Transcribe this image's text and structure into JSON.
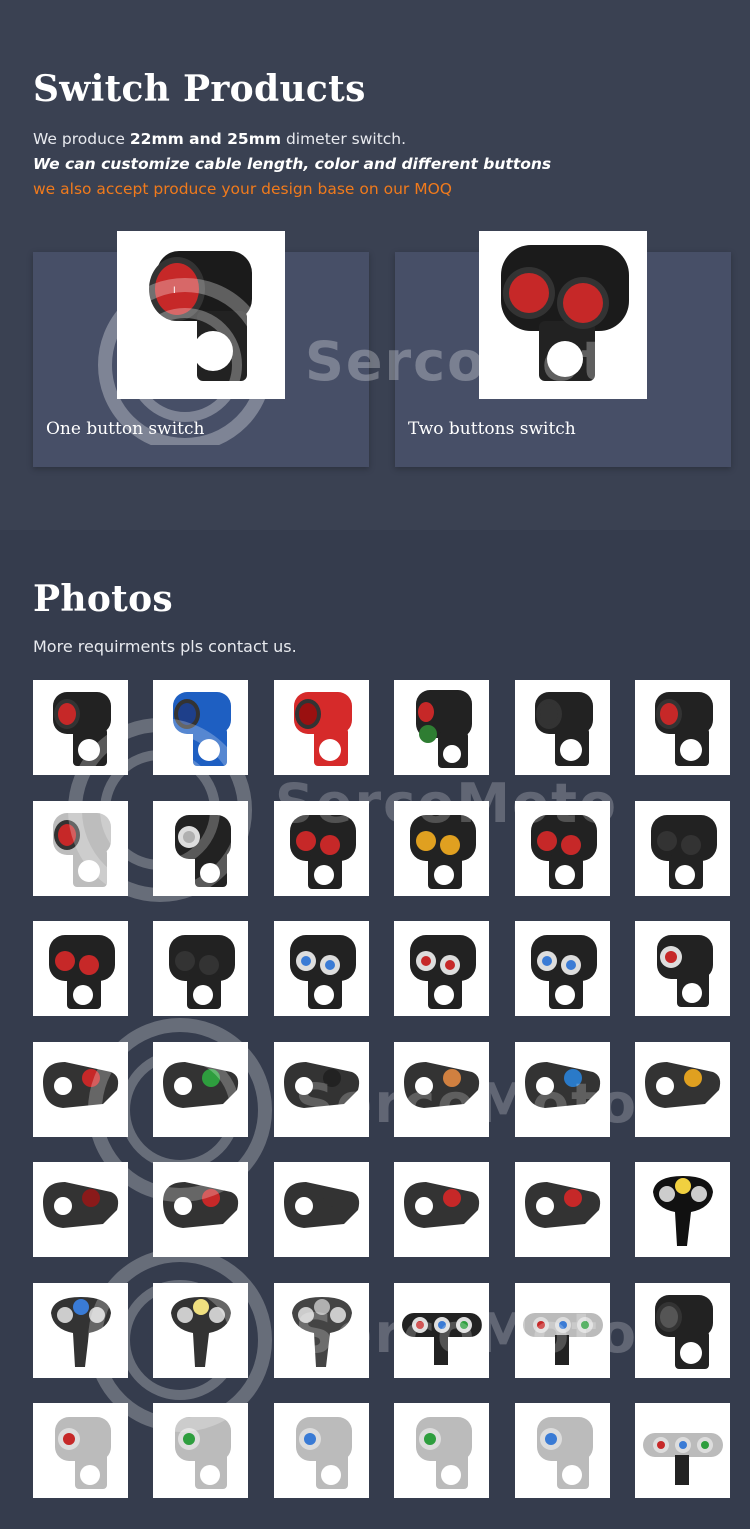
{
  "products": {
    "title": "Switch Products",
    "intro_prefix": "We produce ",
    "intro_bold": "22mm and 25mm",
    "intro_suffix": " dimeter switch.",
    "custom_line": "We can customize cable length, color and different buttons",
    "moq_line": "we also accept produce your design base on our MOQ",
    "accent_color": "#f07a1c",
    "cards": [
      {
        "caption": "One button switch"
      },
      {
        "caption": "Two buttons switch"
      }
    ]
  },
  "photos": {
    "title": "Photos",
    "subtitle": "More requirments pls contact us.",
    "tiles": [
      {
        "body": "#222",
        "btn": "#c62828",
        "kind": "single"
      },
      {
        "body": "#1e5fc2",
        "btn": "#1e3f8a",
        "kind": "single"
      },
      {
        "body": "#d62a2a",
        "btn": "#9a1010",
        "kind": "single"
      },
      {
        "body": "#222",
        "btn": "#c62828",
        "kind": "compass"
      },
      {
        "body": "#222",
        "btn": "#333",
        "kind": "single"
      },
      {
        "body": "#222",
        "btn": "#c62828",
        "kind": "single"
      },
      {
        "body": "#bdbdbd",
        "btn": "#c62828",
        "kind": "single"
      },
      {
        "body": "#222",
        "btn": "#b0b0b0",
        "kind": "ring"
      },
      {
        "body": "#222",
        "btn": "#c62828",
        "kind": "double"
      },
      {
        "body": "#222",
        "btn": "#e0a020",
        "kind": "double"
      },
      {
        "body": "#222",
        "btn": "#c62828",
        "kind": "double"
      },
      {
        "body": "#222",
        "btn": "#333",
        "kind": "double"
      },
      {
        "body": "#222",
        "btn": "#c62828",
        "kind": "double"
      },
      {
        "body": "#222",
        "btn": "#333",
        "kind": "double"
      },
      {
        "body": "#222",
        "btn": "#3a7bd5",
        "kind": "ringdouble"
      },
      {
        "body": "#222",
        "btn": "#c62828",
        "kind": "ringdouble"
      },
      {
        "body": "#222",
        "btn": "#3a7bd5",
        "kind": "ringdouble"
      },
      {
        "body": "#222",
        "btn": "#c62828",
        "kind": "ring"
      },
      {
        "body": "#333",
        "btn": "#c62828",
        "kind": "lever"
      },
      {
        "body": "#333",
        "btn": "#2e9e3e",
        "kind": "lever"
      },
      {
        "body": "#333",
        "btn": "#222",
        "kind": "lever"
      },
      {
        "body": "#333",
        "btn": "#d08040",
        "kind": "lever"
      },
      {
        "body": "#333",
        "btn": "#2a7ac8",
        "kind": "lever"
      },
      {
        "body": "#333",
        "btn": "#e0a020",
        "kind": "lever"
      },
      {
        "body": "#333",
        "btn": "#8a1a1a",
        "kind": "lever"
      },
      {
        "body": "#333",
        "btn": "#c62828",
        "kind": "lever"
      },
      {
        "body": "#333",
        "btn": "#333",
        "kind": "lever"
      },
      {
        "body": "#333",
        "btn": "#c62828",
        "kind": "lever"
      },
      {
        "body": "#333",
        "btn": "#c62828",
        "kind": "lever"
      },
      {
        "body": "#111",
        "btn": "#f0d040",
        "kind": "triple"
      },
      {
        "body": "#333",
        "btn": "#3a7bd5",
        "kind": "triple"
      },
      {
        "body": "#333",
        "btn": "#f0e080",
        "kind": "triple"
      },
      {
        "body": "#444",
        "btn": "#b0b0b0",
        "kind": "triple"
      },
      {
        "body": "#222",
        "btn": "#c62828",
        "kind": "bar"
      },
      {
        "body": "#bbb",
        "btn": "#c62828",
        "kind": "bar"
      },
      {
        "body": "#222",
        "btn": "#555",
        "kind": "single"
      },
      {
        "body": "#bbb",
        "btn": "#c62828",
        "kind": "ring"
      },
      {
        "body": "#bbb",
        "btn": "#2e9e3e",
        "kind": "ring"
      },
      {
        "body": "#bbb",
        "btn": "#3a7bd5",
        "kind": "ring"
      },
      {
        "body": "#bbb",
        "btn": "#2e9e3e",
        "kind": "ring"
      },
      {
        "body": "#bbb",
        "btn": "#3a7bd5",
        "kind": "ring"
      },
      {
        "body": "#bbb",
        "btn": "#c62828",
        "kind": "bar"
      }
    ]
  },
  "watermark": {
    "text": "SercoMoto",
    "icon": "serco-logo-icon"
  }
}
